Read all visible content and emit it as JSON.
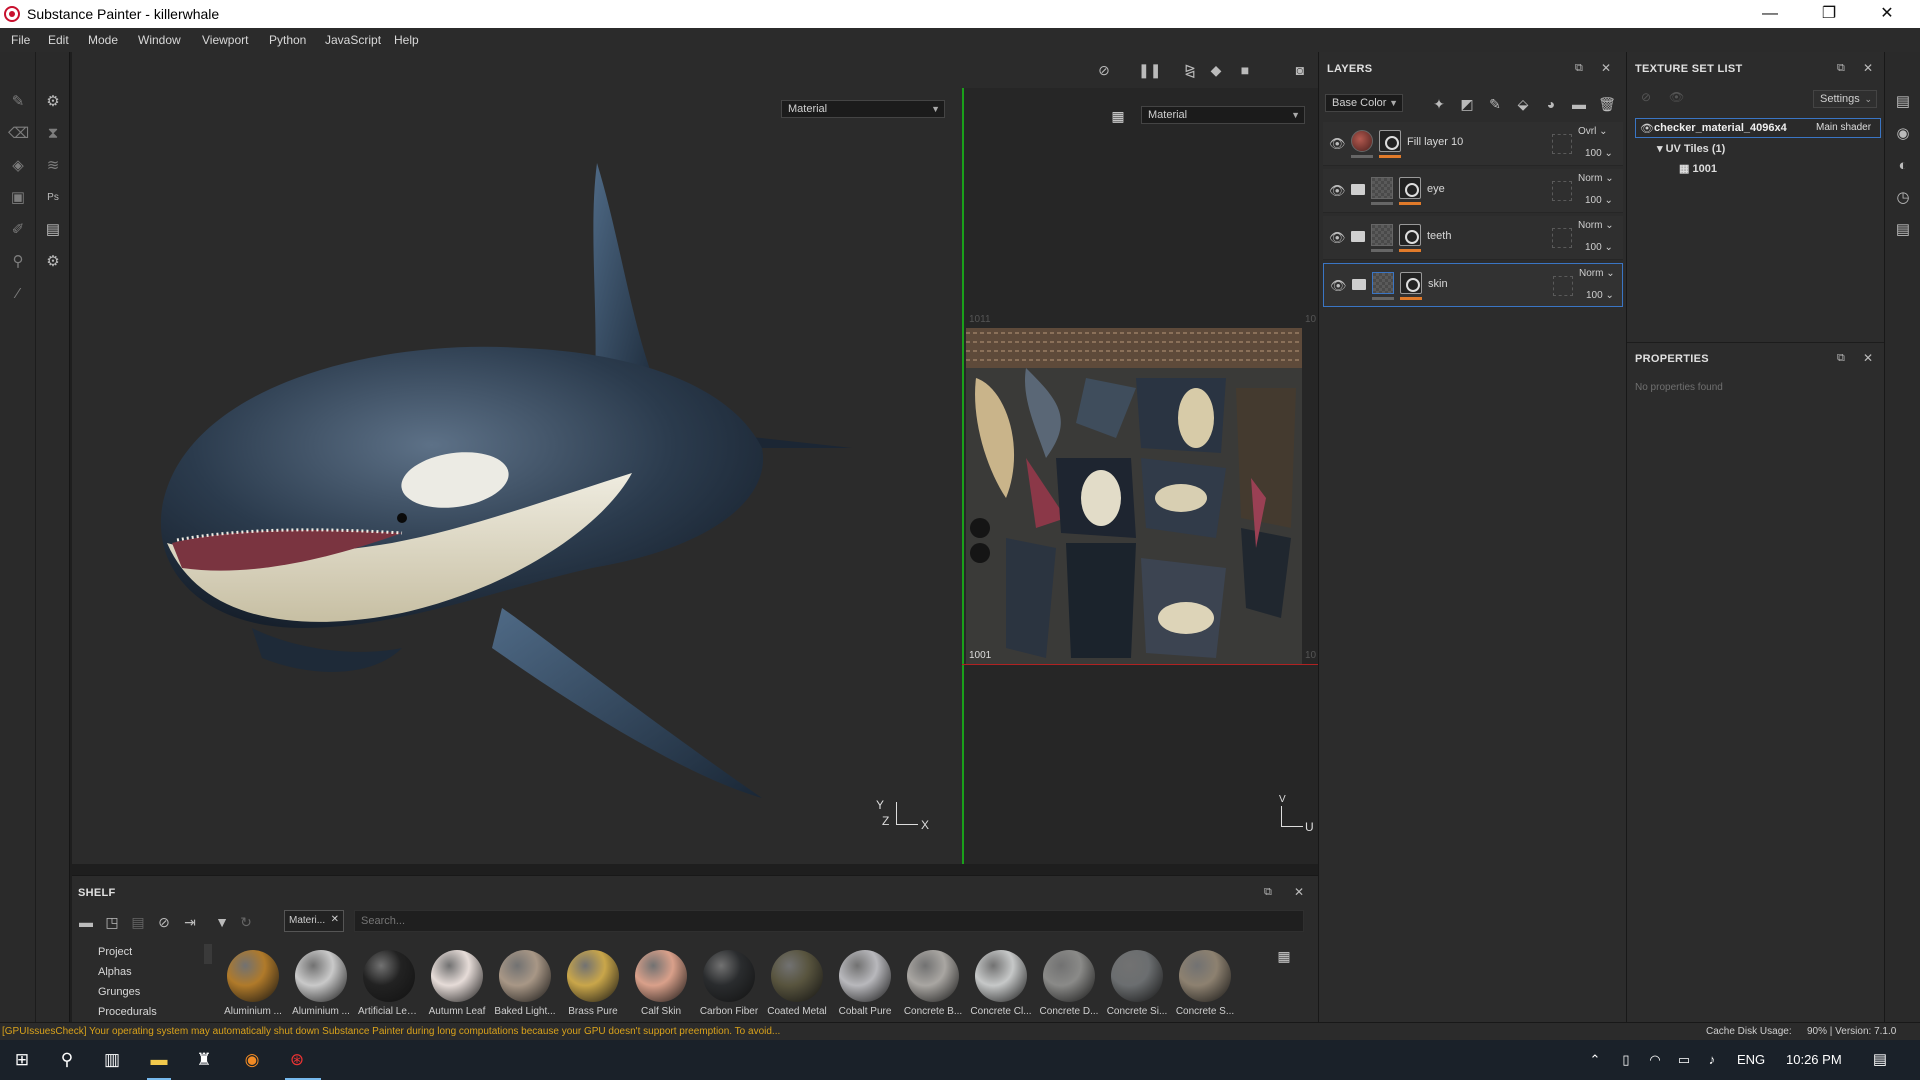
{
  "window": {
    "title": "Substance Painter - killerwhale",
    "minimize_icon": "—",
    "restore_icon": "❐",
    "close_icon": "✕"
  },
  "menu": [
    "File",
    "Edit",
    "Mode",
    "Window",
    "Viewport",
    "Python",
    "JavaScript",
    "Help"
  ],
  "viewport": {
    "left_mode": "Material",
    "right_mode": "Material",
    "uv_tile_label_top": "1011",
    "uv_tile_label_bottom": "1001",
    "uv_edge_label_top": "10",
    "uv_edge_label_bottom": "10",
    "axis_3d_y": "Y",
    "axis_3d_z": "Z",
    "axis_3d_x": "X",
    "axis_2d_v": "V",
    "axis_2d_u": "U"
  },
  "layers": {
    "title": "LAYERS",
    "channel": "Base Color",
    "rows": [
      {
        "name": "Fill layer 10",
        "blend": "Ovrl",
        "opacity": "100"
      },
      {
        "name": "eye",
        "blend": "Norm",
        "opacity": "100"
      },
      {
        "name": "teeth",
        "blend": "Norm",
        "opacity": "100"
      },
      {
        "name": "skin",
        "blend": "Norm",
        "opacity": "100"
      }
    ]
  },
  "texture_set": {
    "title": "TEXTURE SET LIST",
    "settings_label": "Settings",
    "set_name": "checker_material_4096x4",
    "shader": "Main shader",
    "uv_tiles": "UV Tiles (1)",
    "tile": "1001"
  },
  "properties": {
    "title": "PROPERTIES",
    "empty_text": "No properties found"
  },
  "shelf": {
    "title": "SHELF",
    "filter_tag": "Materi...",
    "search_placeholder": "Search...",
    "categories": [
      "Project",
      "Alphas",
      "Grunges",
      "Procedurals"
    ],
    "materials": [
      {
        "name": "Aluminium ...",
        "color": "#b07a2a"
      },
      {
        "name": "Aluminium ...",
        "color": "#c9c9c9"
      },
      {
        "name": "Artificial Lea...",
        "color": "#222222"
      },
      {
        "name": "Autumn Leaf",
        "color": "#e6dcd8"
      },
      {
        "name": "Baked Light...",
        "color": "#a89786"
      },
      {
        "name": "Brass Pure",
        "color": "#c9a64a"
      },
      {
        "name": "Calf Skin",
        "color": "#d9a08a"
      },
      {
        "name": "Carbon Fiber",
        "color": "#2a2c2e"
      },
      {
        "name": "Coated Metal",
        "color": "#58543e"
      },
      {
        "name": "Cobalt Pure",
        "color": "#b8b8bc"
      },
      {
        "name": "Concrete B...",
        "color": "#a9a6a2"
      },
      {
        "name": "Concrete Cl...",
        "color": "#c6c8c8"
      },
      {
        "name": "Concrete D...",
        "color": "#8a8a88"
      },
      {
        "name": "Concrete Si...",
        "color": "#6b6e70"
      },
      {
        "name": "Concrete S...",
        "color": "#8d8170"
      }
    ]
  },
  "status": {
    "message": "[GPUIssuesCheck] Your operating system may automatically shut down Substance Painter during long computations because your GPU doesn't support preemption. To avoid...",
    "cache_label": "Cache Disk Usage:",
    "cache_value": "90% | Version: 7.1.0"
  },
  "taskbar": {
    "lang": "ENG",
    "time": "10:26 PM"
  },
  "colors": {
    "accent_orange": "#e07a2a",
    "selection_blue": "#3a75c4",
    "status_warning": "#d9a21b"
  }
}
